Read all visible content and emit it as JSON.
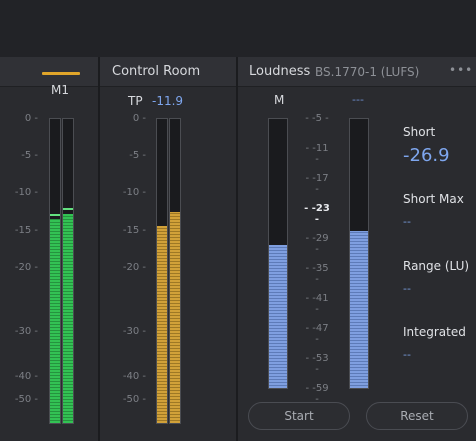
{
  "m1": {
    "label": "M1",
    "scale": [
      "0 -",
      "-5 -",
      "-10 -",
      "-15 -",
      "-20 -",
      "-30 -",
      "-40 -",
      "-50 -"
    ],
    "meters": [
      {
        "level_db": -13.5,
        "peak_db": -12.8
      },
      {
        "level_db": -12.8,
        "peak_db": -12.0
      }
    ]
  },
  "control_room": {
    "title": "Control Room",
    "tp_label": "TP",
    "tp_value": "-11.9",
    "scale": [
      "0 -",
      "-5 -",
      "-10 -",
      "-15 -",
      "-20 -",
      "-30 -",
      "-40 -",
      "-50 -"
    ],
    "meters": [
      {
        "level_db": -14.5
      },
      {
        "level_db": -12.5
      }
    ]
  },
  "loudness": {
    "title": "Loudness",
    "standard": "BS.1770-1 (LUFS)",
    "more_label": "•••",
    "m_label": "M",
    "short_header_value": "---",
    "scale": [
      "- -5 -",
      "- -11 -",
      "- -17 -",
      "- -23 -",
      "- -29 -",
      "- -35 -",
      "- -41 -",
      "- -47 -",
      "- -53 -",
      "- -59 -"
    ],
    "scale_target": "-23",
    "meters": [
      {
        "name": "momentary",
        "level_lufs": -30
      },
      {
        "name": "short-term",
        "level_lufs": -26.9
      }
    ],
    "stats": [
      {
        "label": "Short",
        "value": "-26.9"
      },
      {
        "label": "Short Max",
        "value": "--"
      },
      {
        "label": "Range (LU)",
        "value": "--"
      },
      {
        "label": "Integrated",
        "value": "--"
      }
    ],
    "start_label": "Start",
    "reset_label": "Reset"
  },
  "colors": {
    "m1_meter": "#33c254",
    "control_room_meter": "#d1a139",
    "loudness_meter": "#7f9fe0",
    "accent_value": "#7ea6ee",
    "m1_indicator": "#e0a52a"
  }
}
